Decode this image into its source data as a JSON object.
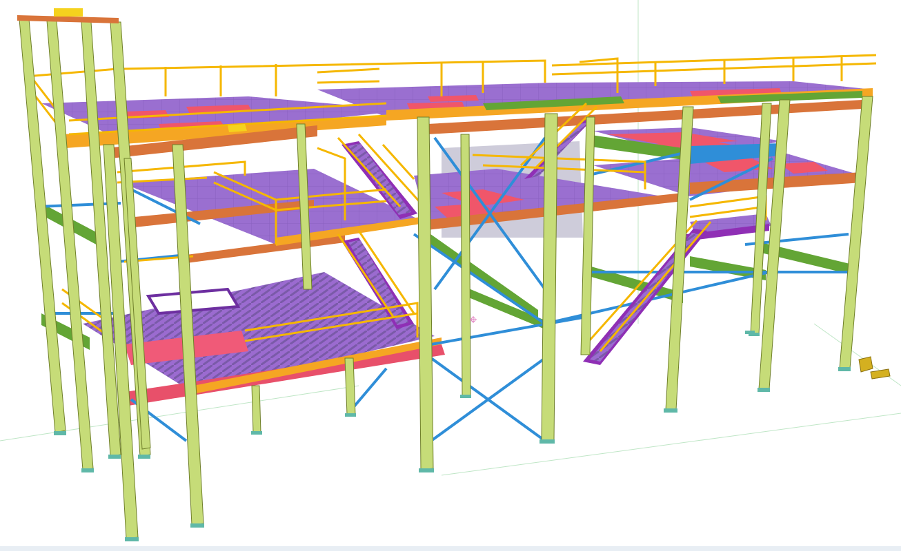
{
  "viewport": {
    "background": "#ffffff",
    "ground_line_color": "#b9e3c0"
  },
  "model": {
    "description_type": "steel-structure-3d",
    "colors": {
      "column": "#c6dc78",
      "column_edge": "#6f7f2a",
      "edge_beam": "#f5a623",
      "main_beam": "#d9743a",
      "secondary_beam": "#63a535",
      "brace": "#2f8ed8",
      "deck": "#9b6bd0",
      "deck_grating": "#7a5aa8",
      "opening": "#f0566a",
      "handrail": "#f5b700",
      "stair_stringer": "#8f2fb5",
      "base_plate": "#5fb8a8",
      "cladding": "#b8b8c8",
      "edge_trim": "#3ea0e0"
    },
    "icons": [
      "column-glyph",
      "brace-glyph",
      "stair-glyph",
      "handrail-glyph",
      "base-plate-glyph",
      "package-icon"
    ]
  }
}
